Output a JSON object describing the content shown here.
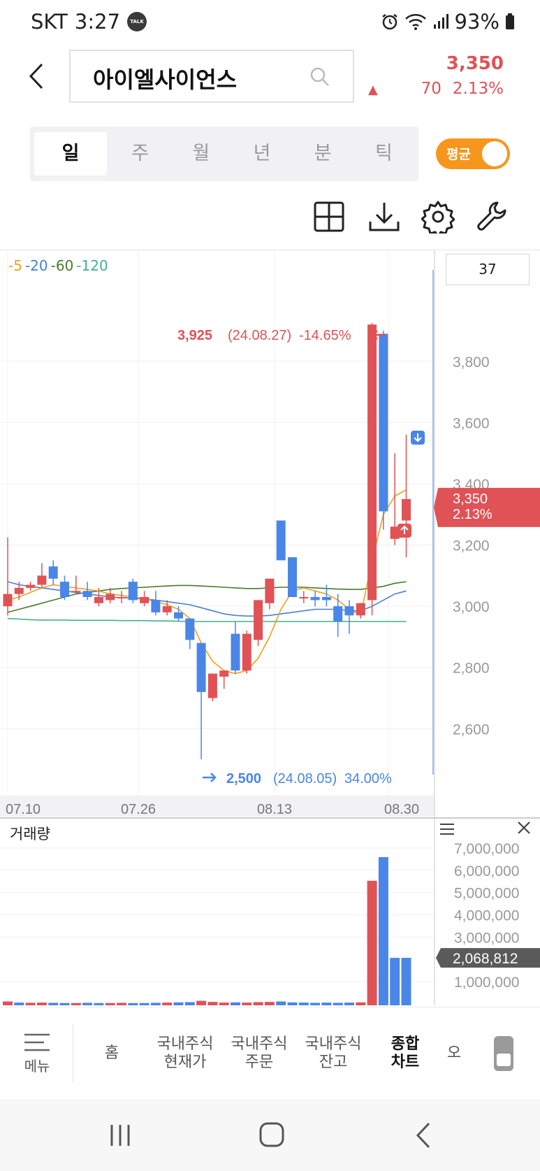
{
  "status": {
    "carrier": "SKT",
    "time": "3:27",
    "talk": "TALK",
    "battery": "93%"
  },
  "stock": {
    "name": "아이엘사이언스",
    "price": "3,350",
    "change": "70",
    "change_pct": "2.13%"
  },
  "period_tabs": [
    {
      "label": "일",
      "active": true
    },
    {
      "label": "주",
      "active": false
    },
    {
      "label": "월",
      "active": false
    },
    {
      "label": "년",
      "active": false
    },
    {
      "label": "분",
      "active": false
    },
    {
      "label": "틱",
      "active": false
    }
  ],
  "avg_toggle": {
    "label": "평균",
    "on": true
  },
  "tools": [
    "grid-icon",
    "download-icon",
    "gear-icon",
    "wrench-icon"
  ],
  "ma_legend": [
    {
      "label": "5",
      "color": "#f0a020"
    },
    {
      "label": "20",
      "color": "#4a7fd4"
    },
    {
      "label": "60",
      "color": "#4a7a30"
    },
    {
      "label": "120",
      "color": "#3fb38a"
    }
  ],
  "candle_count": "37",
  "colors": {
    "up": "#e05255",
    "down": "#4a86e8",
    "accent": "#f7961d"
  },
  "chart_data": [
    {
      "type": "candlestick",
      "x_labels": [
        "07.10",
        "07.26",
        "08.13",
        "08.30"
      ],
      "y_ticks": [
        "3,800",
        "3,600",
        "3,400",
        "3,200",
        "3,000",
        "2,800",
        "2,600"
      ],
      "ylim": [
        2450,
        3980
      ],
      "current_price_label": "3,350",
      "current_pct_label": "2.13%",
      "high_annotation": {
        "price": "3,925",
        "date": "(24.08.27)",
        "pct": "-14.65%"
      },
      "low_annotation": {
        "price": "2,500",
        "date": "(24.08.05)",
        "pct": "34.00%"
      },
      "candles": [
        {
          "o": 3000,
          "h": 3225,
          "l": 2970,
          "c": 3040
        },
        {
          "o": 3040,
          "h": 3080,
          "l": 3020,
          "c": 3060
        },
        {
          "o": 3060,
          "h": 3080,
          "l": 3050,
          "c": 3070
        },
        {
          "o": 3070,
          "h": 3140,
          "l": 3060,
          "c": 3100
        },
        {
          "o": 3130,
          "h": 3150,
          "l": 3070,
          "c": 3090
        },
        {
          "o": 3080,
          "h": 3100,
          "l": 3020,
          "c": 3030
        },
        {
          "o": 3050,
          "h": 3100,
          "l": 3040,
          "c": 3050
        },
        {
          "o": 3050,
          "h": 3080,
          "l": 3020,
          "c": 3030
        },
        {
          "o": 3010,
          "h": 3060,
          "l": 3000,
          "c": 3030
        },
        {
          "o": 3020,
          "h": 3060,
          "l": 3010,
          "c": 3040
        },
        {
          "o": 3030,
          "h": 3050,
          "l": 3010,
          "c": 3030
        },
        {
          "o": 3080,
          "h": 3090,
          "l": 3010,
          "c": 3020
        },
        {
          "o": 3010,
          "h": 3050,
          "l": 3000,
          "c": 3030
        },
        {
          "o": 3020,
          "h": 3050,
          "l": 2970,
          "c": 2980
        },
        {
          "o": 2980,
          "h": 3020,
          "l": 2970,
          "c": 3000
        },
        {
          "o": 2980,
          "h": 3000,
          "l": 2950,
          "c": 2960
        },
        {
          "o": 2960,
          "h": 2960,
          "l": 2860,
          "c": 2890
        },
        {
          "o": 2880,
          "h": 2880,
          "l": 2500,
          "c": 2720
        },
        {
          "o": 2700,
          "h": 2780,
          "l": 2690,
          "c": 2780
        },
        {
          "o": 2770,
          "h": 2790,
          "l": 2730,
          "c": 2790
        },
        {
          "o": 2910,
          "h": 2950,
          "l": 2780,
          "c": 2790
        },
        {
          "o": 2790,
          "h": 2920,
          "l": 2780,
          "c": 2910
        },
        {
          "o": 2890,
          "h": 3020,
          "l": 2870,
          "c": 3020
        },
        {
          "o": 3010,
          "h": 3090,
          "l": 2990,
          "c": 3090
        },
        {
          "o": 3280,
          "h": 3280,
          "l": 3170,
          "c": 3150
        },
        {
          "o": 3160,
          "h": 3160,
          "l": 3030,
          "c": 3030
        },
        {
          "o": 3030,
          "h": 3050,
          "l": 3010,
          "c": 3030
        },
        {
          "o": 3030,
          "h": 3050,
          "l": 3000,
          "c": 3020
        },
        {
          "o": 3030,
          "h": 3070,
          "l": 3000,
          "c": 3020
        },
        {
          "o": 3000,
          "h": 3040,
          "l": 2900,
          "c": 2950
        },
        {
          "o": 3000,
          "h": 3020,
          "l": 2910,
          "c": 2970
        },
        {
          "o": 2970,
          "h": 3010,
          "l": 2960,
          "c": 3010
        },
        {
          "o": 3020,
          "h": 3925,
          "l": 2970,
          "c": 3920
        },
        {
          "o": 3890,
          "h": 3900,
          "l": 3250,
          "c": 3310
        },
        {
          "o": 3220,
          "h": 3500,
          "l": 3200,
          "c": 3260
        },
        {
          "o": 3280,
          "h": 3560,
          "l": 3160,
          "c": 3350
        }
      ],
      "ma": {
        "ma5": [
          3020,
          3030,
          3045,
          3060,
          3070,
          3065,
          3060,
          3055,
          3050,
          3040,
          3035,
          3030,
          3025,
          3015,
          3005,
          2990,
          2960,
          2880,
          2820,
          2790,
          2780,
          2790,
          2830,
          2900,
          2990,
          3050,
          3060,
          3050,
          3040,
          3020,
          2990,
          2970,
          3150,
          3300,
          3360,
          3380
        ],
        "ma20": [
          3080,
          3070,
          3065,
          3060,
          3055,
          3050,
          3045,
          3040,
          3035,
          3030,
          3028,
          3026,
          3024,
          3020,
          3015,
          3010,
          3005,
          2995,
          2985,
          2975,
          2970,
          2968,
          2968,
          2970,
          2975,
          2980,
          2985,
          2990,
          2990,
          2990,
          2985,
          2985,
          3000,
          3020,
          3040,
          3050
        ],
        "ma60": [
          2980,
          2990,
          3000,
          3010,
          3020,
          3030,
          3040,
          3045,
          3050,
          3055,
          3058,
          3060,
          3062,
          3064,
          3066,
          3068,
          3068,
          3066,
          3064,
          3062,
          3060,
          3058,
          3058,
          3060,
          3062,
          3062,
          3062,
          3060,
          3058,
          3056,
          3055,
          3055,
          3060,
          3065,
          3075,
          3080
        ],
        "ma120": [
          2960,
          2958,
          2956,
          2955,
          2955,
          2955,
          2954,
          2954,
          2954,
          2954,
          2953,
          2953,
          2953,
          2952,
          2952,
          2951,
          2950,
          2950,
          2950,
          2950,
          2950,
          2950,
          2950,
          2950,
          2950,
          2950,
          2950,
          2950,
          2950,
          2950,
          2950,
          2950,
          2950,
          2950,
          2950,
          2950
        ]
      }
    },
    {
      "type": "bar",
      "title": "거래량",
      "y_ticks": [
        "7,000,000",
        "6,000,000",
        "5,000,000",
        "4,000,000",
        "3,000,000",
        "1,000,000"
      ],
      "current_label": "2,068,812",
      "values": [
        110000,
        60000,
        50000,
        60000,
        50000,
        40000,
        40000,
        50000,
        40000,
        40000,
        50000,
        40000,
        40000,
        50000,
        60000,
        70000,
        80000,
        140000,
        90000,
        60000,
        70000,
        60000,
        80000,
        90000,
        110000,
        70000,
        60000,
        50000,
        60000,
        50000,
        60000,
        70000,
        5530000,
        6590000,
        2068812,
        2068812
      ],
      "colors_up_down": [
        "u",
        "d",
        "u",
        "u",
        "d",
        "d",
        "u",
        "d",
        "d",
        "u",
        "u",
        "d",
        "d",
        "d",
        "u",
        "d",
        "d",
        "u",
        "u",
        "u",
        "d",
        "u",
        "u",
        "u",
        "d",
        "d",
        "d",
        "d",
        "d",
        "d",
        "d",
        "u",
        "u",
        "d",
        "d",
        "d"
      ]
    }
  ],
  "bottom_nav": [
    {
      "label": "메뉴",
      "active": false
    },
    {
      "label": "홈",
      "active": false
    },
    {
      "label": "국내주식\n현재가",
      "active": false
    },
    {
      "label": "국내주식\n주문",
      "active": false
    },
    {
      "label": "국내주식\n잔고",
      "active": false
    },
    {
      "label": "종합\n차트",
      "active": true
    },
    {
      "label": "오",
      "active": false
    }
  ]
}
